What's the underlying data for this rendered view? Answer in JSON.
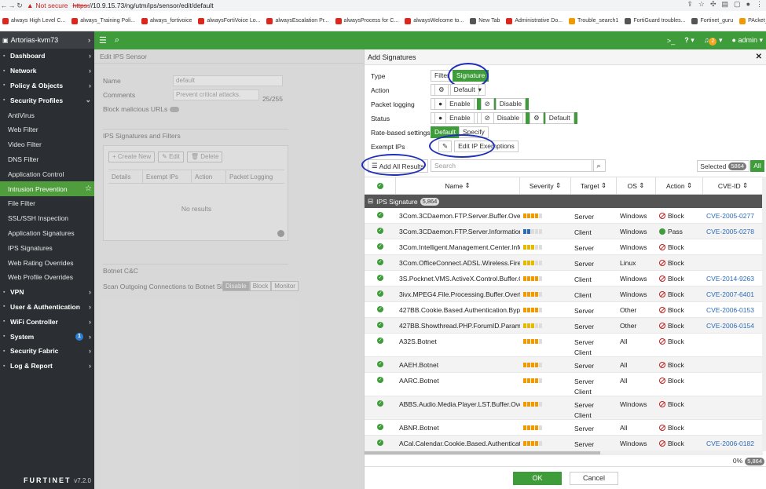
{
  "browser": {
    "warning": "Not secure",
    "url_scheme": "https:",
    "url_rest": "//10.9.15.73/ng/utm/ips/sensor/edit/default",
    "bookmarks": [
      {
        "label": "always High Level C...",
        "color": "#e1251b"
      },
      {
        "label": "always_Training Poli...",
        "color": "#e1251b"
      },
      {
        "label": "always_fortivoice",
        "color": "#e1251b"
      },
      {
        "label": "alwaysFortiVoice Lo...",
        "color": "#e1251b"
      },
      {
        "label": "alwaysEscalation Pr...",
        "color": "#e1251b"
      },
      {
        "label": "alwaysProcess for C...",
        "color": "#e1251b"
      },
      {
        "label": "alwaysWelcome to...",
        "color": "#e1251b"
      },
      {
        "label": "New Tab",
        "color": "#555555"
      },
      {
        "label": "Administrative Do...",
        "color": "#e1251b"
      },
      {
        "label": "Trouble_search1",
        "color": "#f29900"
      },
      {
        "label": "FortiGuard troubles...",
        "color": "#555555"
      },
      {
        "label": "Fortinet_guru",
        "color": "#555555"
      },
      {
        "label": "PAcket_sniffer",
        "color": "#f29900"
      }
    ]
  },
  "sidebar": {
    "device": "Artorias-kvm73",
    "items": [
      {
        "label": "Dashboard",
        "arrow": true
      },
      {
        "label": "Network",
        "arrow": true
      },
      {
        "label": "Policy & Objects",
        "arrow": true
      },
      {
        "label": "Security Profiles",
        "open": true
      },
      {
        "label": "AntiVirus",
        "sub": true
      },
      {
        "label": "Web Filter",
        "sub": true
      },
      {
        "label": "Video Filter",
        "sub": true
      },
      {
        "label": "DNS Filter",
        "sub": true
      },
      {
        "label": "Application Control",
        "sub": true
      },
      {
        "label": "Intrusion Prevention",
        "sub": true,
        "active": true
      },
      {
        "label": "File Filter",
        "sub": true
      },
      {
        "label": "SSL/SSH Inspection",
        "sub": true
      },
      {
        "label": "Application Signatures",
        "sub": true
      },
      {
        "label": "IPS Signatures",
        "sub": true
      },
      {
        "label": "Web Rating Overrides",
        "sub": true
      },
      {
        "label": "Web Profile Overrides",
        "sub": true
      },
      {
        "label": "VPN",
        "arrow": true
      },
      {
        "label": "User & Authentication",
        "arrow": true
      },
      {
        "label": "WiFi Controller",
        "arrow": true
      },
      {
        "label": "System",
        "arrow": true,
        "badge": "1"
      },
      {
        "label": "Security Fabric",
        "arrow": true
      },
      {
        "label": "Log & Report",
        "arrow": true
      }
    ],
    "logo": "FURTINET",
    "version": "v7.2.0"
  },
  "topbar": {
    "cli": ">_",
    "help": "?",
    "bell_count": "2",
    "user": "admin"
  },
  "edit": {
    "header": "Edit IPS Sensor",
    "name_label": "Name",
    "name_value": "default",
    "comments_label": "Comments",
    "comments_value": "Prevent critical attacks.",
    "comments_count": "25/255",
    "block_label": "Block malicious URLs",
    "sigs_title": "IPS Signatures and Filters",
    "create_new": "+ Create New",
    "edit": "Edit",
    "delete": "Delete",
    "cols": [
      "Details",
      "Exempt IPs",
      "Action",
      "Packet Logging"
    ],
    "no_results": "No results",
    "botnet_title": "Botnet C&C",
    "scan_label": "Scan Outgoing Connections to Botnet Sites",
    "scan_opts": [
      "Disable",
      "Block",
      "Monitor"
    ]
  },
  "panel": {
    "title": "Add Signatures",
    "type_label": "Type",
    "type_opts": [
      "Filter",
      "Signature"
    ],
    "action_label": "Action",
    "action_value": "Default",
    "plog_label": "Packet logging",
    "plog_opts": [
      "Enable",
      "Disable"
    ],
    "status_label": "Status",
    "status_opts": [
      "Enable",
      "Disable",
      "Default"
    ],
    "rate_label": "Rate-based settings",
    "rate_opts": [
      "Default",
      "Specify"
    ],
    "exempt_label": "Exempt IPs",
    "exempt_btn": "Edit IP Exemptions",
    "add_all": "Add All Results",
    "search_placeholder": "Search",
    "selected_label": "Selected",
    "selected_count": "5864",
    "all_btn": "All",
    "columns": [
      "Name",
      "Severity",
      "Target",
      "OS",
      "Action",
      "CVE-ID"
    ],
    "group_label": "IPS Signature",
    "group_count": "5,864",
    "rows": [
      {
        "name": "3Com.3CDaemon.FTP.Server.Buffer.Overfl...",
        "sev": 4,
        "sevc": "#f29900",
        "target": "Server",
        "os": "Windows",
        "action": "Block",
        "cve": "CVE-2005-0277"
      },
      {
        "name": "3Com.3CDaemon.FTP.Server.Information.D...",
        "sev": 2,
        "sevc": "#2d6cb5",
        "target": "Client",
        "os": "Windows",
        "action": "Pass",
        "cve": "CVE-2005-0278"
      },
      {
        "name": "3Com.Intelligent.Management.Center.Infor...",
        "sev": 3,
        "sevc": "#e6b800",
        "target": "Server",
        "os": "Windows",
        "action": "Block",
        "cve": ""
      },
      {
        "name": "3Com.OfficeConnect.ADSL.Wireless.Firew...",
        "sev": 3,
        "sevc": "#e6b800",
        "target": "Server",
        "os": "Linux",
        "action": "Block",
        "cve": ""
      },
      {
        "name": "3S.Pocknet.VMS.ActiveX.Control.Buffer.Ov...",
        "sev": 4,
        "sevc": "#f29900",
        "target": "Client",
        "os": "Windows",
        "action": "Block",
        "cve": "CVE-2014-9263"
      },
      {
        "name": "3ivx.MPEG4.File.Processing.Buffer.Overflow",
        "sev": 4,
        "sevc": "#f29900",
        "target": "Client",
        "os": "Windows",
        "action": "Block",
        "cve": "CVE-2007-6401"
      },
      {
        "name": "427BB.Cookie.Based.Authentication.Bypass",
        "sev": 4,
        "sevc": "#f29900",
        "target": "Server",
        "os": "Other",
        "action": "Block",
        "cve": "CVE-2006-0153"
      },
      {
        "name": "427BB.Showthread.PHP.ForumID.Paramet...",
        "sev": 3,
        "sevc": "#e6b800",
        "target": "Server",
        "os": "Other",
        "action": "Block",
        "cve": "CVE-2006-0154"
      },
      {
        "name": "A32S.Botnet",
        "sev": 4,
        "sevc": "#f29900",
        "target": "Server Client",
        "os": "All",
        "action": "Block",
        "cve": ""
      },
      {
        "name": "AAEH.Botnet",
        "sev": 4,
        "sevc": "#f29900",
        "target": "Server",
        "os": "All",
        "action": "Block",
        "cve": ""
      },
      {
        "name": "AARC.Botnet",
        "sev": 4,
        "sevc": "#f29900",
        "target": "Server Client",
        "os": "All",
        "action": "Block",
        "cve": ""
      },
      {
        "name": "ABBS.Audio.Media.Player.LST.Buffer.Overfl...",
        "sev": 4,
        "sevc": "#f29900",
        "target": "Server Client",
        "os": "Windows",
        "action": "Block",
        "cve": ""
      },
      {
        "name": "ABNR.Botnet",
        "sev": 4,
        "sevc": "#f29900",
        "target": "Server",
        "os": "All",
        "action": "Block",
        "cve": ""
      },
      {
        "name": "ACal.Calendar.Cookie.Based.Authenticatio...",
        "sev": 4,
        "sevc": "#f29900",
        "target": "Server",
        "os": "Windows",
        "action": "Block",
        "cve": "CVE-2006-0182"
      }
    ],
    "progress": "0%",
    "footer_count": "5,864",
    "ok": "OK",
    "cancel": "Cancel"
  }
}
